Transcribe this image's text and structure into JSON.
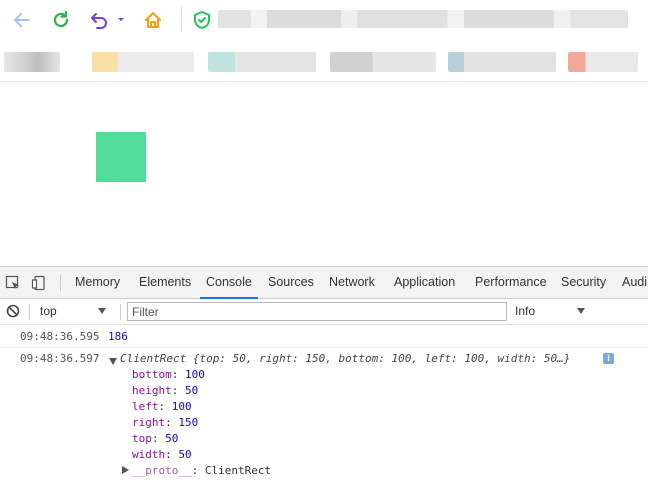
{
  "browser": {
    "colors": {
      "back": "#9ec5f0",
      "reload": "#2bb24c",
      "undo": "#7c3aed",
      "home": "#f59e0b",
      "shield": "#22c55e"
    },
    "icons": [
      "back-icon",
      "reload-icon",
      "undo-icon",
      "home-icon",
      "shield-icon"
    ]
  },
  "page": {
    "box_color": "#52dc9a"
  },
  "devtools": {
    "tabs": [
      "Memory",
      "Elements",
      "Console",
      "Sources",
      "Network",
      "Application",
      "Performance",
      "Security",
      "Audi"
    ],
    "active_tab": "Console",
    "context": "top",
    "filter_placeholder": "Filter",
    "level": "Info",
    "console": {
      "messages": [
        {
          "timestamp": "09:48:36.595",
          "value": "186"
        },
        {
          "timestamp": "09:48:36.597",
          "summary": "ClientRect {top: 50, right: 150, bottom: 100, left: 100, width: 50…}",
          "info_badge": "i",
          "properties": [
            {
              "key": "bottom",
              "value": "100"
            },
            {
              "key": "height",
              "value": "50"
            },
            {
              "key": "left",
              "value": "100"
            },
            {
              "key": "right",
              "value": "150"
            },
            {
              "key": "top",
              "value": "50"
            },
            {
              "key": "width",
              "value": "50"
            }
          ],
          "proto_key": "__proto__",
          "proto_value": "ClientRect"
        }
      ],
      "prompt": ">"
    }
  }
}
